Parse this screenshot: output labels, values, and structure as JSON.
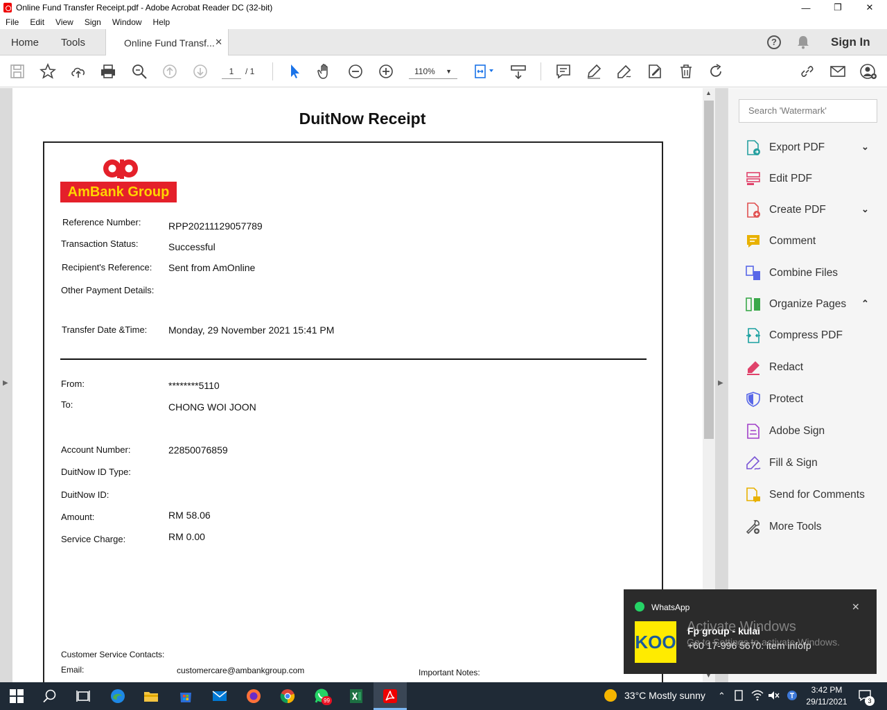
{
  "window": {
    "title": "Online Fund Transfer Receipt.pdf - Adobe Acrobat Reader DC (32-bit)",
    "minimize": "—",
    "maximize": "❐",
    "close": "✕"
  },
  "menu": [
    "File",
    "Edit",
    "View",
    "Sign",
    "Window",
    "Help"
  ],
  "tabs": {
    "home": "Home",
    "tools": "Tools",
    "document": "Online Fund Transf...",
    "close_glyph": "✕",
    "help_glyph": "?",
    "sign_in": "Sign In"
  },
  "toolbar": {
    "page_current": "1",
    "page_total": "/ 1",
    "zoom": "110%",
    "zoom_arrow": "▼"
  },
  "document": {
    "title": "DuitNow Receipt",
    "logo_text": "AmBank Group",
    "fields": {
      "reference_label": "Reference Number:",
      "reference_value": "RPP20211129057789",
      "status_label": "Transaction Status:",
      "status_value": "Successful",
      "recipient_ref_label": "Recipient's Reference:",
      "recipient_ref_value": "Sent from AmOnline",
      "other_details_label": "Other Payment Details:",
      "date_label": "Transfer Date &Time:",
      "date_value": "Monday, 29 November 2021 15:41 PM",
      "from_label": "From:",
      "from_value": "********5110",
      "to_label": "To:",
      "to_value": "CHONG WOI JOON",
      "account_label": "Account Number:",
      "account_value": "22850076859",
      "id_type_label": "DuitNow ID Type:",
      "id_label": "DuitNow ID:",
      "amount_label": "Amount:",
      "amount_value": "RM 58.06",
      "charge_label": "Service Charge:",
      "charge_value": "RM 0.00",
      "contacts_label": "Customer Service Contacts:",
      "email_label": "Email:",
      "email_value": "customercare@ambankgroup.com",
      "notes_label": "Important Notes:"
    }
  },
  "right_panel": {
    "search_placeholder": "Search 'Watermark'",
    "tools": [
      {
        "label": "Export PDF",
        "chevron": "⌄",
        "color": "#26a0a0"
      },
      {
        "label": "Edit PDF",
        "chevron": "",
        "color": "#e0426a"
      },
      {
        "label": "Create PDF",
        "chevron": "⌄",
        "color": "#e05050"
      },
      {
        "label": "Comment",
        "chevron": "",
        "color": "#e8b100"
      },
      {
        "label": "Combine Files",
        "chevron": "",
        "color": "#5867e8"
      },
      {
        "label": "Organize Pages",
        "chevron": "⌃",
        "color": "#3aa84a"
      },
      {
        "label": "Compress PDF",
        "chevron": "",
        "color": "#1aa0a0"
      },
      {
        "label": "Redact",
        "chevron": "",
        "color": "#e0426a"
      },
      {
        "label": "Protect",
        "chevron": "",
        "color": "#5867e8"
      },
      {
        "label": "Adobe Sign",
        "chevron": "",
        "color": "#a13fc9"
      },
      {
        "label": "Fill & Sign",
        "chevron": "",
        "color": "#7a55d6"
      },
      {
        "label": "Send for Comments",
        "chevron": "",
        "color": "#e8b100"
      },
      {
        "label": "More Tools",
        "chevron": "",
        "color": "#555555"
      }
    ]
  },
  "notification": {
    "app": "WhatsApp",
    "close_glyph": "✕",
    "thumb_text": "KOO",
    "group": "Fp group - kulai",
    "message": "+60 17-996 5670: item infofp"
  },
  "watermark": {
    "line1": "Activate Windows",
    "line2": "Go to Settings to activate Windows."
  },
  "taskbar": {
    "weather": "33°C  Mostly sunny",
    "time": "3:42 PM",
    "date": "29/11/2021",
    "whatsapp_badge": "99",
    "notification_count": "3"
  }
}
